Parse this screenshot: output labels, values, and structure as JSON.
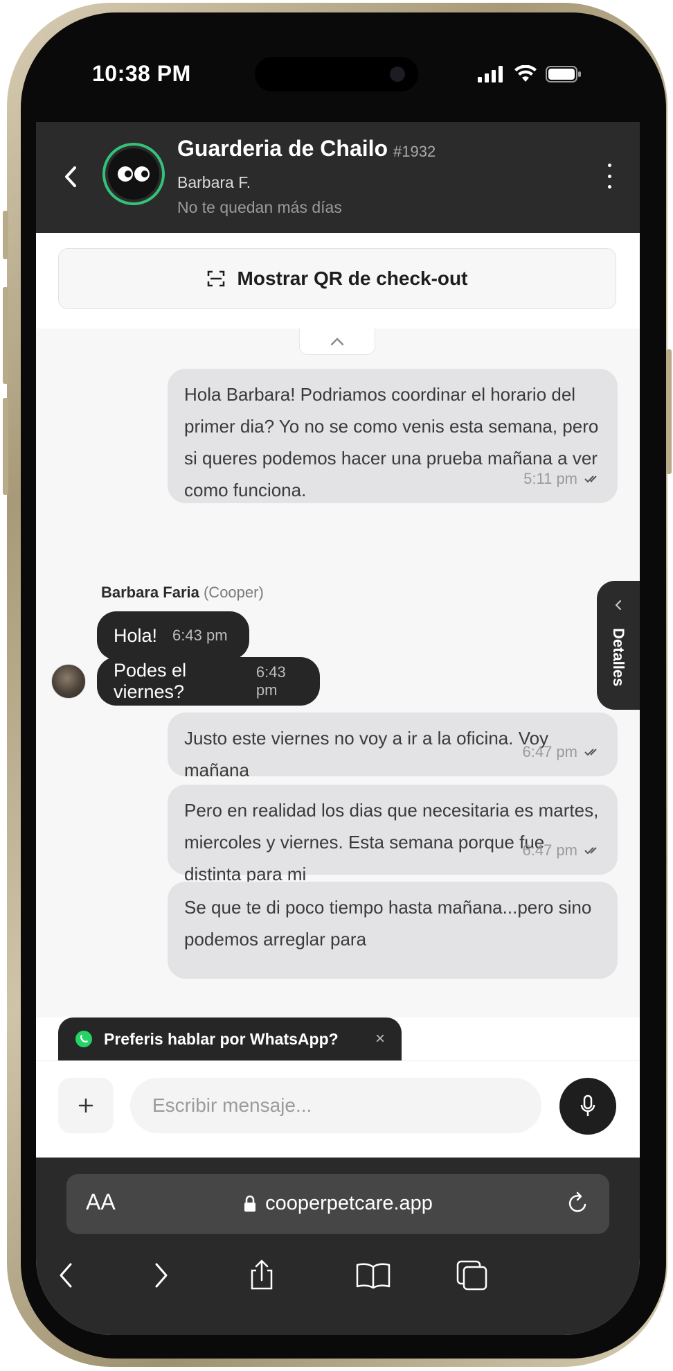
{
  "status_bar": {
    "time": "10:38 PM"
  },
  "header": {
    "business_name": "Guarderia de Chailo",
    "business_id": "#1932",
    "client_name": "Barbara F.",
    "client_subtitle": "No te quedan más días"
  },
  "qr_button": {
    "label": "Mostrar QR de check-out"
  },
  "messages": [
    {
      "direction": "outgoing",
      "text": "Hola Barbara! Podriamos coordinar el horario del primer dia? Yo no se como venis esta semana, pero si queres podemos hacer una prueba mañana a ver como funciona.",
      "time": "5:11 pm"
    },
    {
      "direction": "incoming",
      "sender": "Barbara Faria",
      "sender_tag": "(Cooper)",
      "text": "Hola!",
      "time": "6:43 pm"
    },
    {
      "direction": "incoming",
      "text": "Podes el viernes?",
      "time": "6:43 pm"
    },
    {
      "direction": "outgoing",
      "text": "Justo este viernes no voy a ir a la oficina. Voy mañana",
      "time": "6:47 pm"
    },
    {
      "direction": "outgoing",
      "text": "Pero en realidad los dias que necesitaria es martes, miercoles y viernes. Esta semana porque fue distinta para mi",
      "time": "6:47 pm"
    },
    {
      "direction": "outgoing",
      "text": "Se que te di poco tiempo hasta mañana...pero sino podemos arreglar para",
      "time": ""
    }
  ],
  "details_tab": {
    "label": "Detalles"
  },
  "whatsapp_banner": {
    "text": "Preferis hablar por WhatsApp?",
    "close": "×"
  },
  "composer": {
    "placeholder": "Escribir mensaje...",
    "plus": "+"
  },
  "browser": {
    "text_size": "AA",
    "url": "cooperpetcare.app"
  },
  "colors": {
    "accent_green": "#34c27a",
    "header_bg": "#2b2b2b",
    "outgoing_bubble": "#e3e3e6",
    "incoming_bubble": "#262626"
  }
}
